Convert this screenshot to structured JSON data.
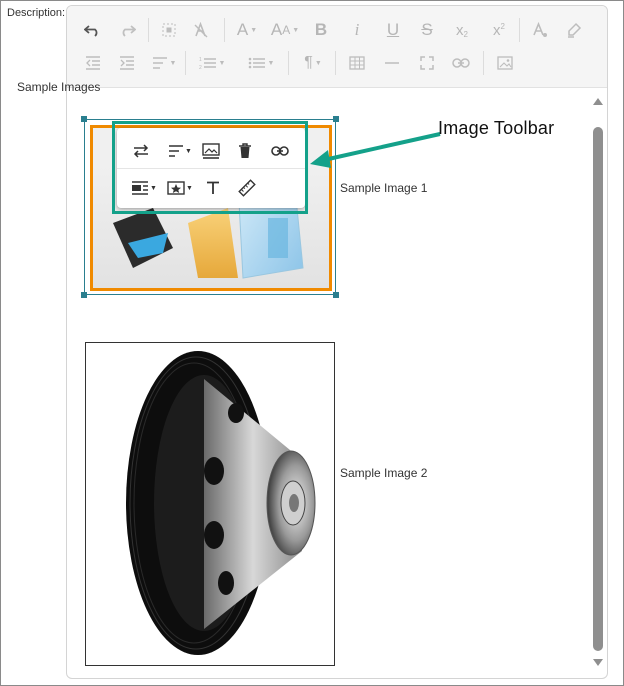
{
  "form": {
    "description_label": "Description:"
  },
  "editor": {
    "heading": "Sample Images",
    "images": [
      {
        "caption": "Sample Image 1"
      },
      {
        "caption": "Sample Image 2"
      }
    ]
  },
  "toolbar": {
    "row1": [
      "undo-icon",
      "redo-icon",
      "select-all-icon",
      "clear-format-icon",
      "font-name-icon",
      "font-size-icon",
      "bold-icon",
      "italic-icon",
      "underline-icon",
      "strikethrough-icon",
      "subscript-icon",
      "superscript-icon",
      "font-color-icon",
      "background-color-icon"
    ],
    "row2": [
      "outdent-icon",
      "indent-icon",
      "alignment-icon",
      "ordered-list-icon",
      "unordered-list-icon",
      "paragraph-format-icon",
      "table-icon",
      "horizontal-line-icon",
      "fullscreen-icon",
      "link-icon",
      "insert-image-icon"
    ]
  },
  "image_toolbar": {
    "row1": [
      "replace-icon",
      "align-icon",
      "caption-icon",
      "remove-icon",
      "link-icon"
    ],
    "row2": [
      "display-icon",
      "style-icon",
      "alternate-text-icon",
      "change-size-icon"
    ]
  },
  "annotation": {
    "label": "Image Toolbar",
    "color": "#14a18a"
  },
  "colors": {
    "accent": "#14a18a",
    "selection": "#2a7f8f",
    "image_border": "#f08a00"
  }
}
